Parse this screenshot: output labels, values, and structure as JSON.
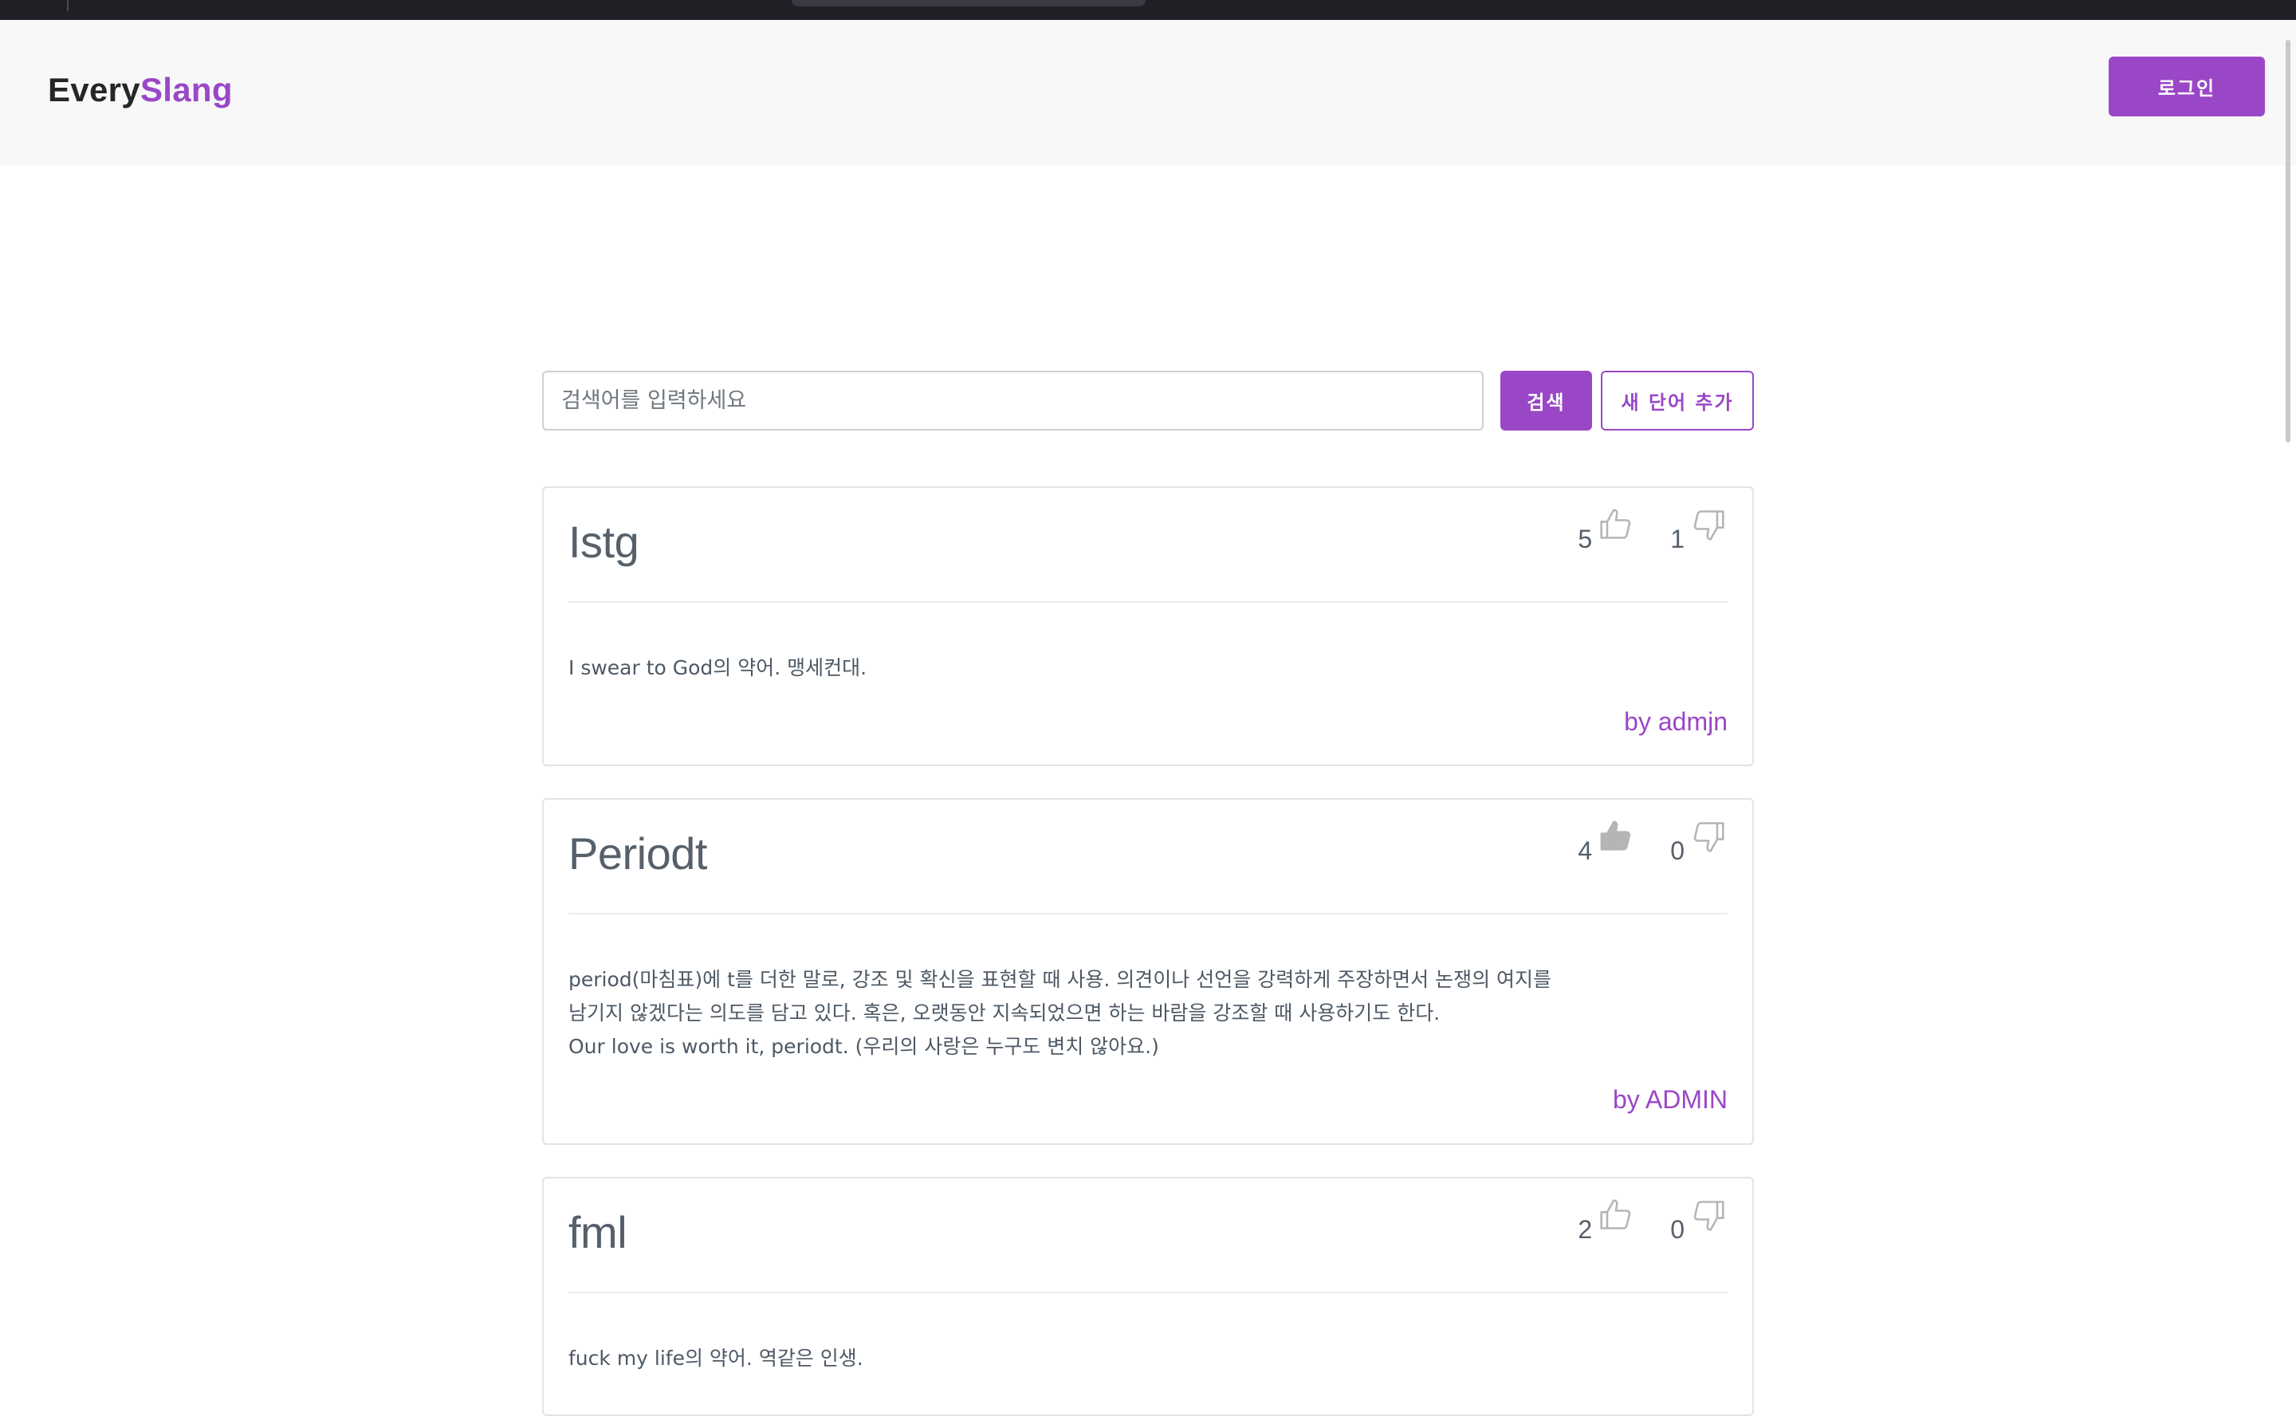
{
  "header": {
    "brand_part1": "Every",
    "brand_part2": "Slang",
    "login_label": "로그인"
  },
  "search": {
    "placeholder": "검색어를 입력하세요",
    "search_label": "검색",
    "add_label": "새 단어 추가"
  },
  "colors": {
    "accent": "#9a47c7",
    "header_bg": "#f8f8f8",
    "text": "#56606b"
  },
  "cards": [
    {
      "term": "Istg",
      "likes": "5",
      "dislikes": "1",
      "liked": false,
      "desc_lines": [
        "I swear to God의 약어. 맹세컨대."
      ],
      "author": "by admjn"
    },
    {
      "term": "Periodt",
      "likes": "4",
      "dislikes": "0",
      "liked": true,
      "desc_lines": [
        "period(마침표)에 t를 더한 말로, 강조 및 확신을 표현할 때 사용. 의견이나 선언을 강력하게 주장하면서 논쟁의 여지를",
        "남기지 않겠다는 의도를 담고 있다. 혹은, 오랫동안 지속되었으면 하는 바람을 강조할 때 사용하기도 한다.",
        "Our love is worth it, periodt. (우리의 사랑은 누구도 변치 않아요.)"
      ],
      "author": "by ADMIN"
    },
    {
      "term": "fml",
      "likes": "2",
      "dislikes": "0",
      "liked": false,
      "desc_lines": [
        "fuck my life의 약어. 역같은 인생."
      ],
      "author": ""
    }
  ],
  "icons": {
    "like": "thumbs-up-icon",
    "dislike": "thumbs-down-icon"
  }
}
